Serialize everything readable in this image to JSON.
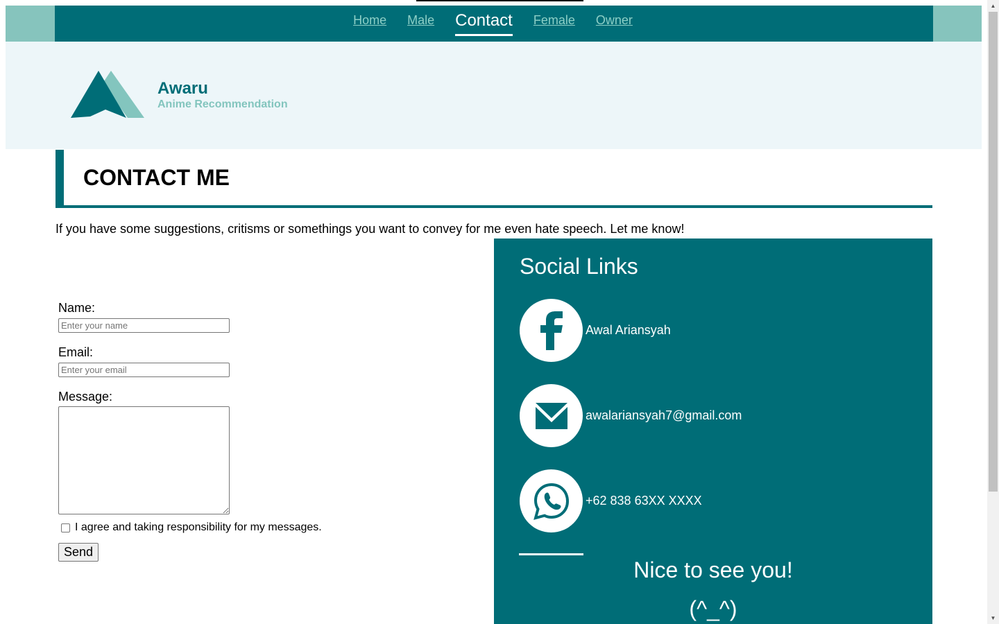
{
  "nav": {
    "items": [
      {
        "label": "Home",
        "active": false
      },
      {
        "label": "Male",
        "active": false
      },
      {
        "label": "Contact",
        "active": true
      },
      {
        "label": "Female",
        "active": false
      },
      {
        "label": "Owner",
        "active": false
      }
    ]
  },
  "header": {
    "brand_name": "Awaru",
    "brand_subtitle": "Anime Recommendation"
  },
  "page": {
    "title": "CONTACT ME",
    "intro": "If you have some suggestions, critisms or somethings you want to convey for me even hate speech. Let me know!"
  },
  "form": {
    "name_label": "Name:",
    "name_placeholder": "Enter your name",
    "name_value": "",
    "email_label": "Email:",
    "email_placeholder": "Enter your email",
    "email_value": "",
    "message_label": "Message:",
    "message_value": "",
    "agree_label": "I agree and taking responsibility for my messages.",
    "agree_checked": false,
    "send_label": "Send"
  },
  "social": {
    "title": "Social Links",
    "items": [
      {
        "icon": "facebook-icon",
        "label": "Awal Ariansyah"
      },
      {
        "icon": "mail-icon",
        "label": "awalariansyah7@gmail.com"
      },
      {
        "icon": "whatsapp-icon",
        "label": "+62 838 63XX XXXX"
      }
    ],
    "greeting": "Nice to see you!",
    "emoticon": "(^_^)"
  },
  "colors": {
    "primary": "#006d77",
    "accent": "#83c5be",
    "light_bg": "#edf6f9",
    "white": "#ffffff"
  }
}
